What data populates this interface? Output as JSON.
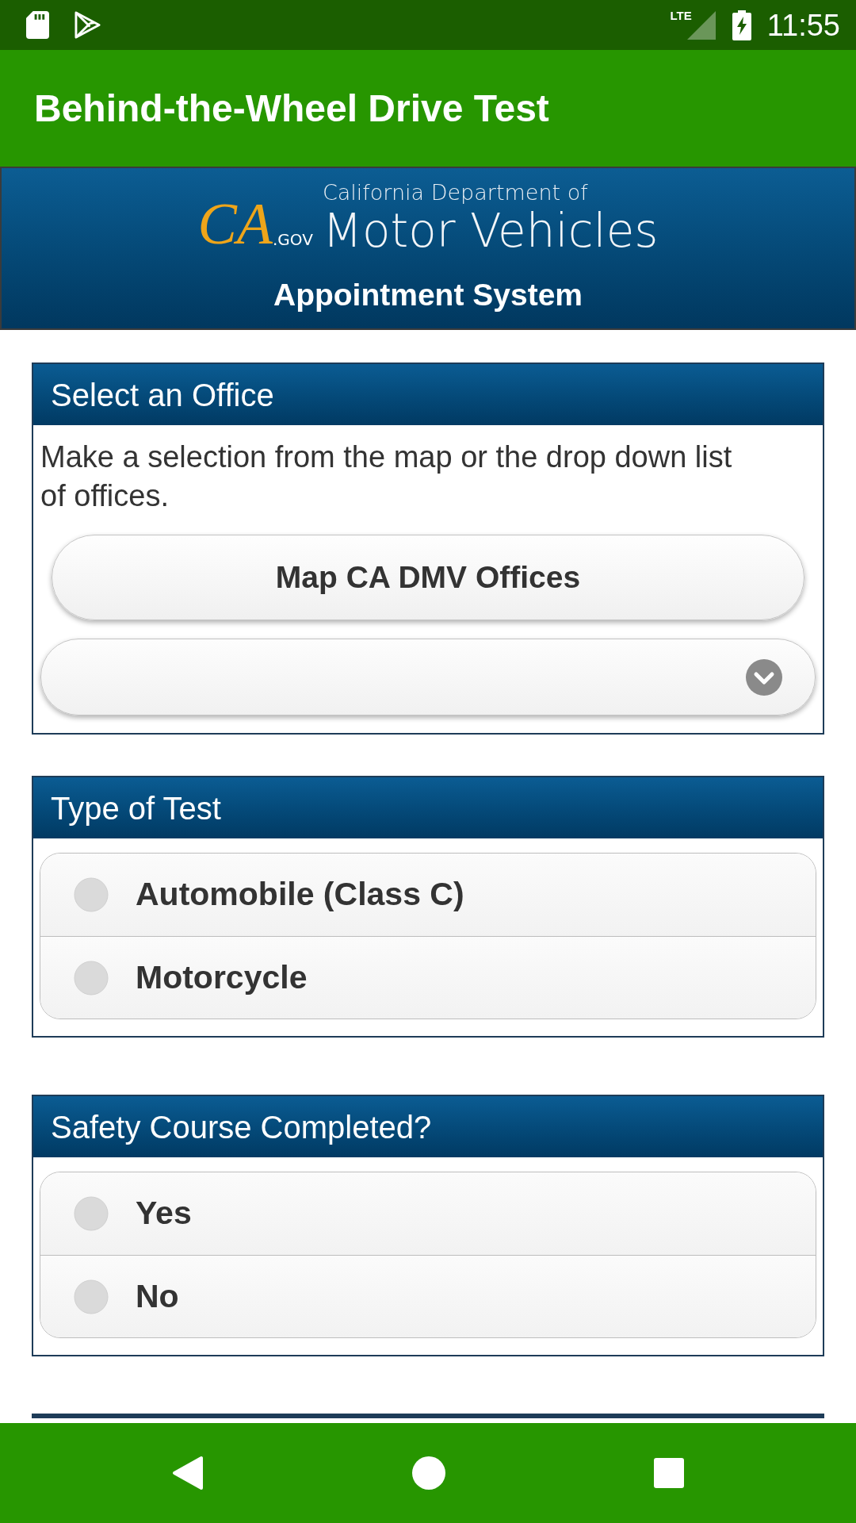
{
  "status_bar": {
    "network": "LTE",
    "time": "11:55"
  },
  "app_bar": {
    "title": "Behind-the-Wheel Drive Test"
  },
  "banner": {
    "logo": {
      "mark": "CA",
      "domain": ".GOV",
      "tagline": "California Department of",
      "name": "Motor Vehicles"
    },
    "subtitle": "Appointment System"
  },
  "sections": [
    {
      "kind": "office",
      "title": "Select an Office",
      "instructions": "Make a selection from the map or the drop down list of offices.",
      "button": "Map CA DMV Offices"
    },
    {
      "kind": "radio",
      "title": "Type of Test",
      "options": [
        {
          "label": "Automobile (Class C)",
          "selected": false
        },
        {
          "label": "Motorcycle",
          "selected": false
        }
      ]
    },
    {
      "kind": "radio",
      "title": "Safety Course Completed?",
      "options": [
        {
          "label": "Yes",
          "selected": false
        },
        {
          "label": "No",
          "selected": false
        }
      ]
    }
  ]
}
